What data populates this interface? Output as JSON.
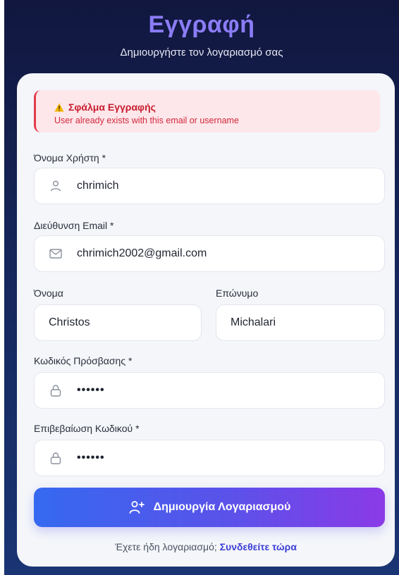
{
  "header": {
    "title": "Εγγραφή",
    "subtitle": "Δημιουργήστε τον λογαριασμό σας"
  },
  "alert": {
    "title": "Σφάλμα Εγγραφής",
    "message": "User already exists with this email or username",
    "icon": "warning-icon"
  },
  "form": {
    "username": {
      "label": "Όνομα Χρήστη *",
      "value": "chrimich",
      "icon": "user-icon"
    },
    "email": {
      "label": "Διεύθυνση Email *",
      "value": "chrimich2002@gmail.com",
      "icon": "mail-icon"
    },
    "first_name": {
      "label": "Όνομα",
      "value": "Christos"
    },
    "last_name": {
      "label": "Επώνυμο",
      "value": "Michalari"
    },
    "password": {
      "label": "Κωδικός Πρόσβασης *",
      "value": "••••••",
      "icon": "lock-icon"
    },
    "confirm_password": {
      "label": "Επιβεβαίωση Κωδικού *",
      "value": "••••••",
      "icon": "lock-icon"
    }
  },
  "submit": {
    "label": "Δημιουργία Λογαριασμού",
    "icon": "user-plus-icon"
  },
  "footer": {
    "text": "Έχετε ήδη λογαριασμό; ",
    "link": "Συνδεθείτε τώρα"
  },
  "colors": {
    "accent_start": "#3569f0",
    "accent_end": "#8a3ae6",
    "error": "#c81c2e",
    "title": "#8b7cf6"
  }
}
